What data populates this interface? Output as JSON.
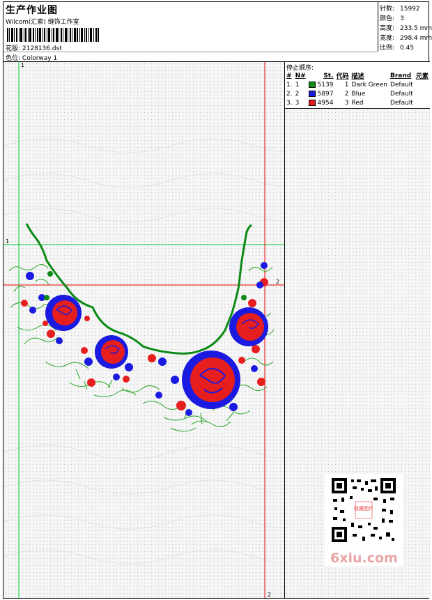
{
  "header": {
    "title": "生产作业图",
    "studio": "Wilcom(汇索) 缝饰工作室",
    "design_label": "花版:",
    "design_file": "2128136.dst",
    "colorway_label": "色位:",
    "colorway": "Colorway 1"
  },
  "stats": [
    {
      "label": "针数:",
      "value": "15992"
    },
    {
      "label": "颜色:",
      "value": "3"
    },
    {
      "label": "高度:",
      "value": "233.5 mm"
    },
    {
      "label": "宽度:",
      "value": "298.4 mm"
    },
    {
      "label": "比例:",
      "value": "0.45"
    }
  ],
  "stop_sequence": {
    "title": "停止顺序:",
    "columns": [
      "#",
      "N#",
      "St.",
      "代码",
      "描述",
      "Brand",
      "元素"
    ],
    "rows": [
      {
        "idx": "1.",
        "n": "1",
        "color": "#0a8a14",
        "st": "5139",
        "code": "1",
        "desc": "Dark Green",
        "brand": "Default"
      },
      {
        "idx": "2.",
        "n": "2",
        "color": "#1a1ae0",
        "st": "5897",
        "code": "2",
        "desc": "Blue",
        "brand": "Default"
      },
      {
        "idx": "3.",
        "n": "3",
        "color": "#e61e1e",
        "st": "4954",
        "code": "3",
        "desc": "Red",
        "brand": "Default"
      }
    ]
  },
  "guides": {
    "green_v_label": "1",
    "green_h_label": "1",
    "red_v_label": "2",
    "red_h_label": "2"
  },
  "colors": {
    "green_guide": "#00cc33",
    "red_guide": "#e60000",
    "thread_green": "#0a8a14",
    "thread_blue": "#1a1ae0",
    "thread_red": "#e61e1e"
  },
  "watermark": {
    "site": "6xiu.com",
    "qr_stamp": "收藏图片"
  }
}
